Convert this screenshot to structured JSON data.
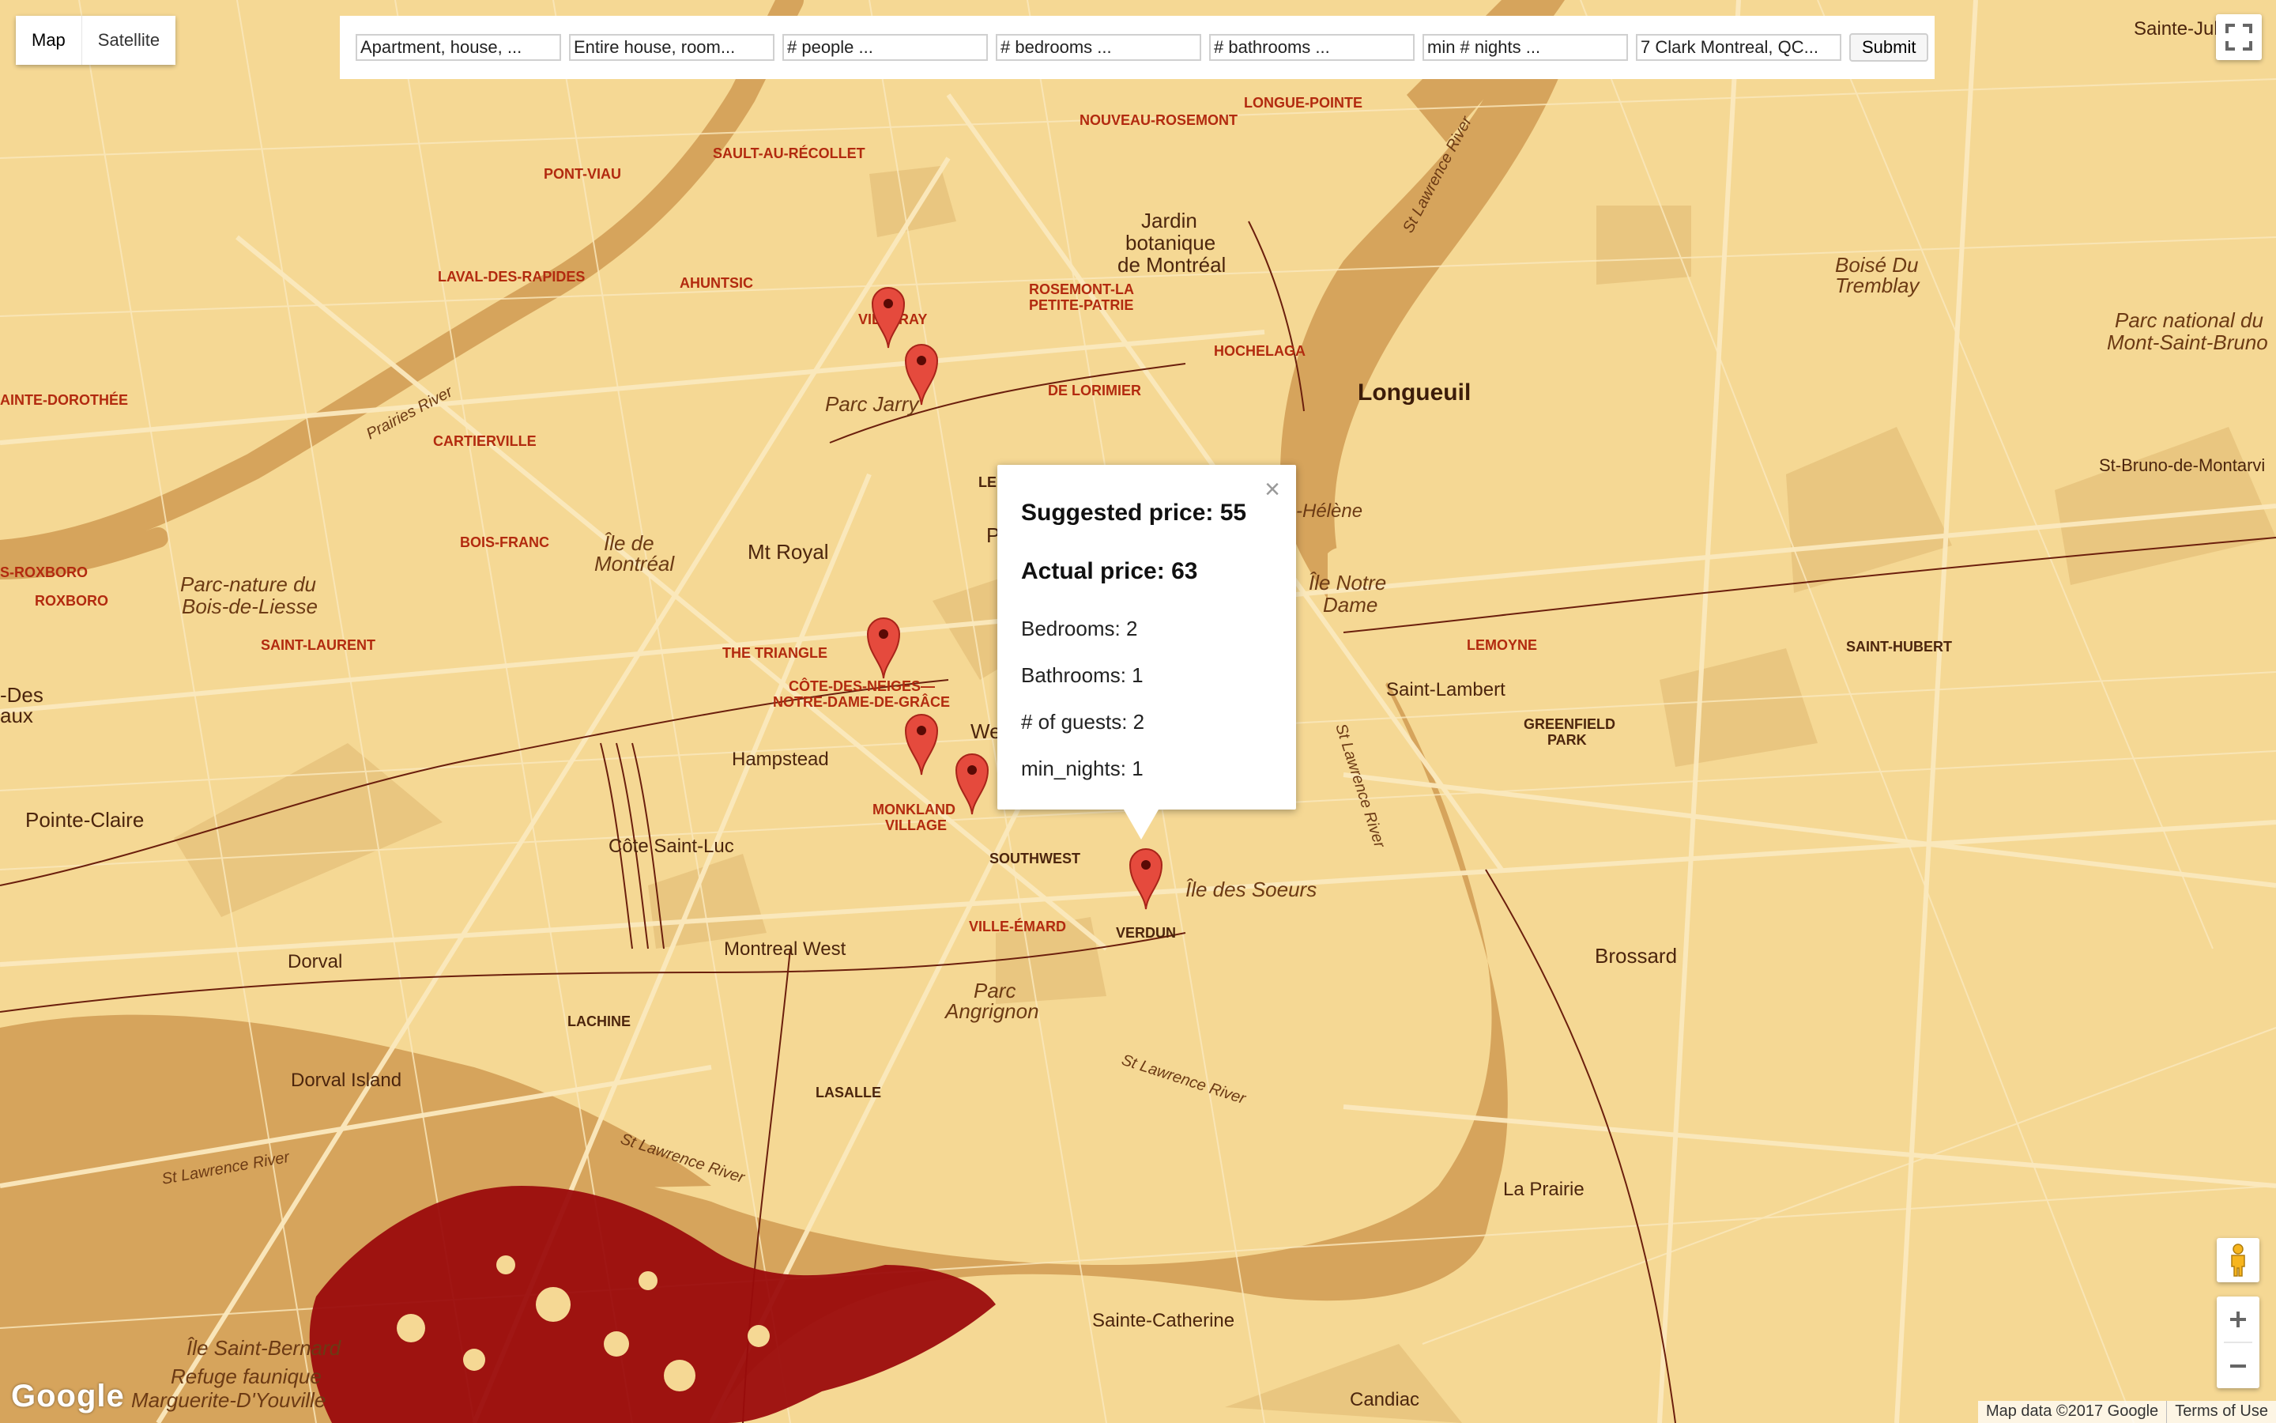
{
  "map_type": {
    "options": [
      "Map",
      "Satellite"
    ],
    "selected": "Map"
  },
  "search_form": {
    "fields": [
      {
        "placeholder": "Apartment, house, ..."
      },
      {
        "placeholder": "Entire house, room..."
      },
      {
        "placeholder": "# people ..."
      },
      {
        "placeholder": "# bedrooms ..."
      },
      {
        "placeholder": "# bathrooms ..."
      },
      {
        "placeholder": "min # nights ..."
      },
      {
        "value": "7 Clark Montreal, QC..."
      }
    ],
    "submit_label": "Submit"
  },
  "info_window": {
    "suggested_label": "Suggested price: ",
    "suggested_value": "55",
    "actual_label": "Actual price: ",
    "actual_value": "63",
    "bedrooms_label": "Bedrooms: ",
    "bedrooms_value": "2",
    "bathrooms_label": "Bathrooms: ",
    "bathrooms_value": "1",
    "guests_label": "# of guests: ",
    "guests_value": "2",
    "min_nights_label": "min_nights: ",
    "min_nights_value": "1",
    "close": "×"
  },
  "pins_count": 6,
  "colors": {
    "land": "#f5d894",
    "water": "#d6a45c",
    "roads": "#fbe9be",
    "park": "#e8c47d",
    "pin": "#e54a3d",
    "dense_red": "#9b0c0c"
  },
  "map_labels": {
    "cities_big": [
      "Longueuil",
      "Mt Royal",
      "Brossard",
      "Pointe-Claire",
      "Dorval",
      "Montreal West",
      "Hampstead",
      "Côte Saint-Luc",
      "Saint-Lambert",
      "La Prairie",
      "Sainte-Catherine",
      "Candiac",
      "Dorval Island",
      "Sainte-Julie"
    ],
    "neighborhoods": [
      "NOUVEAU-ROSEMONT",
      "LONGUE-POINTE",
      "SAULT-AU-RÉCOLLET",
      "PONT-VIAU",
      "LAVAL-DES-RAPIDES",
      "AHUNTSIC",
      "VILLERAY",
      "ROSEMONT-LA",
      "PETITE-PATRIE",
      "HOCHELAGA",
      "DE LORIMIER",
      "CARTIERVILLE",
      "BOIS-FRANC",
      "SAINT-LAURENT",
      "ROXBORO",
      "S-ROXBORO",
      "AINTE-DOROTHÉE",
      "THE TRIANGLE",
      "CÔTE-DES-NEIGES—",
      "NOTRE-DAME-DE-GRÂCE",
      "MONKLAND",
      "VILLAGE",
      "SOUTHWEST",
      "VILLE-ÉMARD",
      "VERDUN",
      "LACHINE",
      "LASALLE",
      "LEMOYNE",
      "GREENFIELD",
      "PARK",
      "SAINT-HUBERT",
      "LE"
    ],
    "parks": [
      "Jardin",
      "botanique",
      "de Montréal",
      "Parc Jarry",
      "Île de",
      "Montréal",
      "Parc-nature du",
      "Bois-de-Liesse",
      "Parc",
      "Angrignon",
      "Île des Soeurs",
      "Île Notre",
      "Dame",
      "-Hélène",
      "Boisé Du",
      "Tremblay",
      "Parc national du",
      "Mont-Saint-Bruno",
      "St-Bruno-de-Montarvi",
      "Île Saint-Bernard",
      "Refuge faunique",
      "Marguerite-D'Youville",
      "-Des",
      "aux",
      "We",
      "P"
    ],
    "rivers": [
      "St Lawrence River",
      "Prairies River"
    ]
  },
  "attribution": {
    "map_data": "Map data ©2017 Google",
    "terms": "Terms of Use",
    "logo": "Google"
  }
}
